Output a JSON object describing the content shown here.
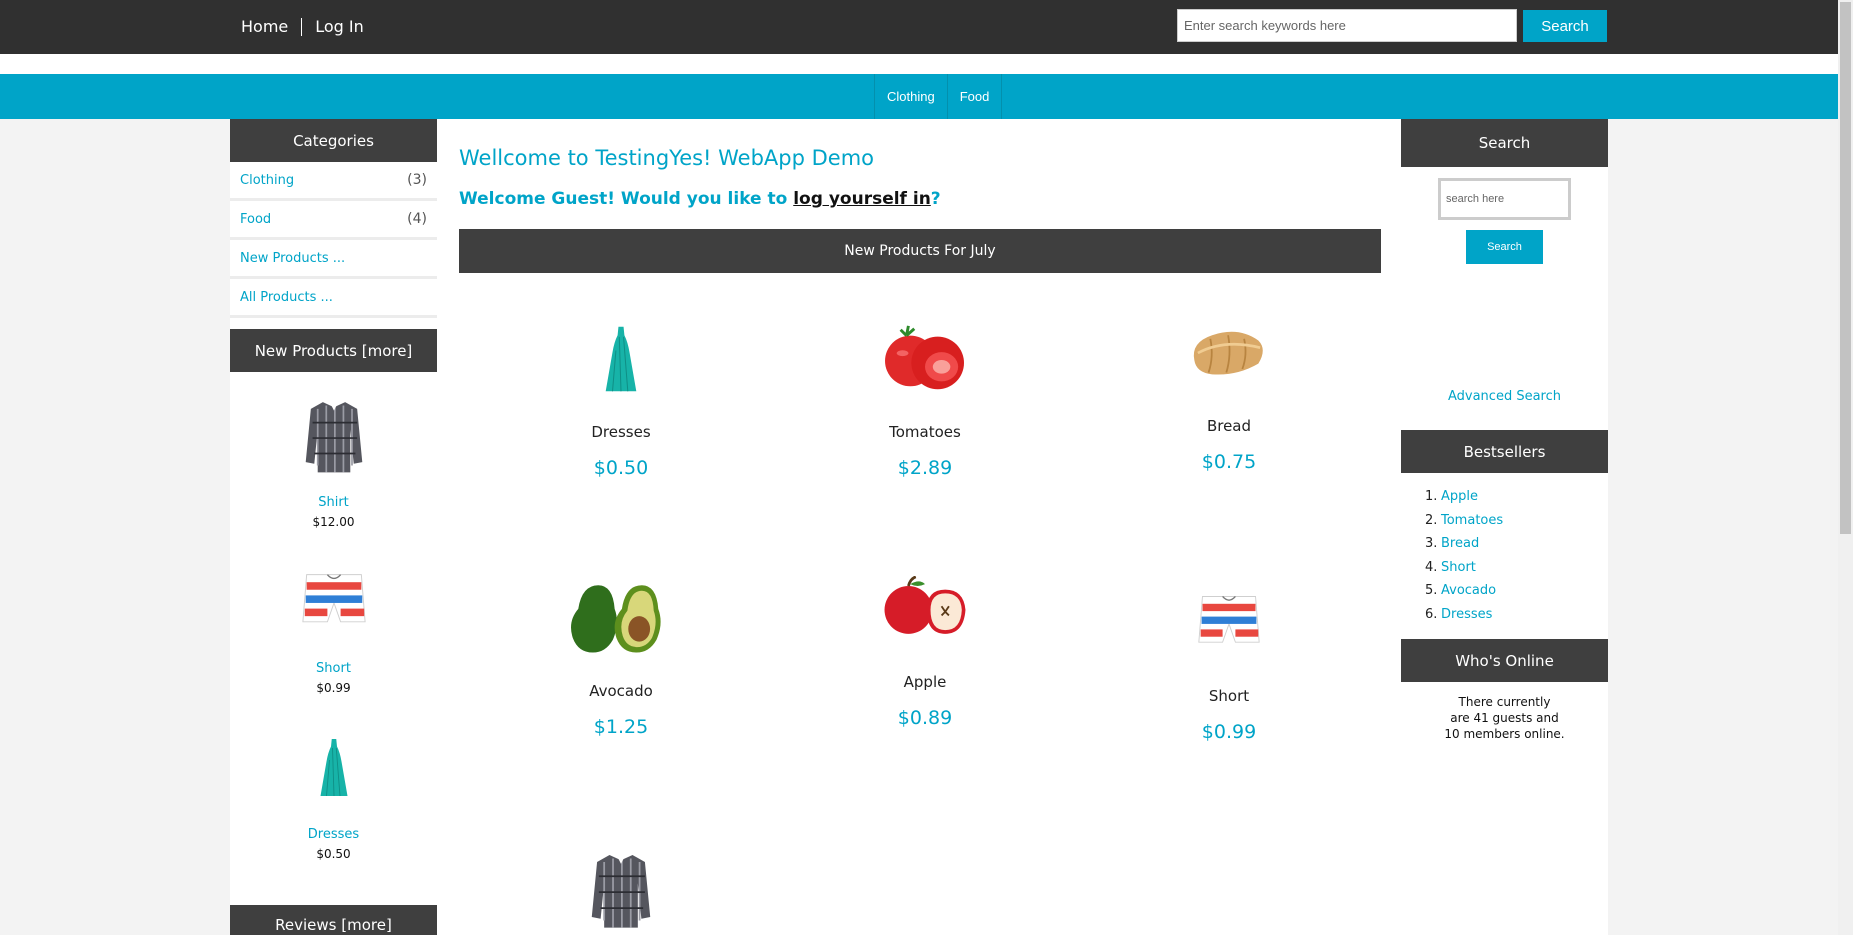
{
  "top": {
    "nav": [
      {
        "label": "Home"
      },
      {
        "label": "Log In"
      }
    ],
    "search_placeholder": "Enter search keywords here",
    "search_button": "Search"
  },
  "category_bar": [
    {
      "label": "Clothing"
    },
    {
      "label": "Food"
    }
  ],
  "left": {
    "categories_title": "Categories",
    "categories": [
      {
        "label": "Clothing",
        "count": "(3)"
      },
      {
        "label": "Food",
        "count": "(4)"
      },
      {
        "label": "New Products ...",
        "count": ""
      },
      {
        "label": "All Products ...",
        "count": ""
      }
    ],
    "new_products_title": "New Products  [more]",
    "new_products": [
      {
        "name": "Shirt",
        "price": "$12.00",
        "icon": "shirt-icon"
      },
      {
        "name": "Short",
        "price": "$0.99",
        "icon": "short-icon"
      },
      {
        "name": "Dresses",
        "price": "$0.50",
        "icon": "dress-icon"
      }
    ],
    "reviews_title": "Reviews  [more]"
  },
  "main": {
    "welcome_title": "Wellcome to TestingYes! WebApp Demo",
    "welcome_guest_prefix": "Welcome Guest! Would you like to ",
    "welcome_guest_link": "log yourself in",
    "welcome_guest_suffix": "?",
    "banner": "New Products For July",
    "products": [
      {
        "name": "Dresses",
        "price": "$0.50",
        "icon": "dress-icon"
      },
      {
        "name": "Tomatoes",
        "price": "$2.89",
        "icon": "tomato-icon"
      },
      {
        "name": "Bread",
        "price": "$0.75",
        "icon": "bread-icon"
      },
      {
        "name": "Avocado",
        "price": "$1.25",
        "icon": "avocado-icon"
      },
      {
        "name": "Apple",
        "price": "$0.89",
        "icon": "apple-icon"
      },
      {
        "name": "Short",
        "price": "$0.99",
        "icon": "short-icon"
      },
      {
        "name": "",
        "price": "",
        "icon": "shirt-icon"
      }
    ]
  },
  "right": {
    "search_title": "Search",
    "search_placeholder": "search here",
    "search_button": "Search",
    "advanced_search": "Advanced Search",
    "bestsellers_title": "Bestsellers",
    "bestsellers": [
      {
        "num": "1.",
        "label": "Apple"
      },
      {
        "num": "2.",
        "label": "Tomatoes"
      },
      {
        "num": "3.",
        "label": "Bread"
      },
      {
        "num": "4.",
        "label": "Short"
      },
      {
        "num": "5.",
        "label": "Avocado"
      },
      {
        "num": "6.",
        "label": "Dresses"
      }
    ],
    "whos_online_title": "Who's Online",
    "whos_online_lines": [
      "There currently",
      "are 41 guests and",
      "10 members online."
    ]
  },
  "colors": {
    "accent": "#00a4c8",
    "dark": "#3f3f3f",
    "topbar": "#303030"
  }
}
